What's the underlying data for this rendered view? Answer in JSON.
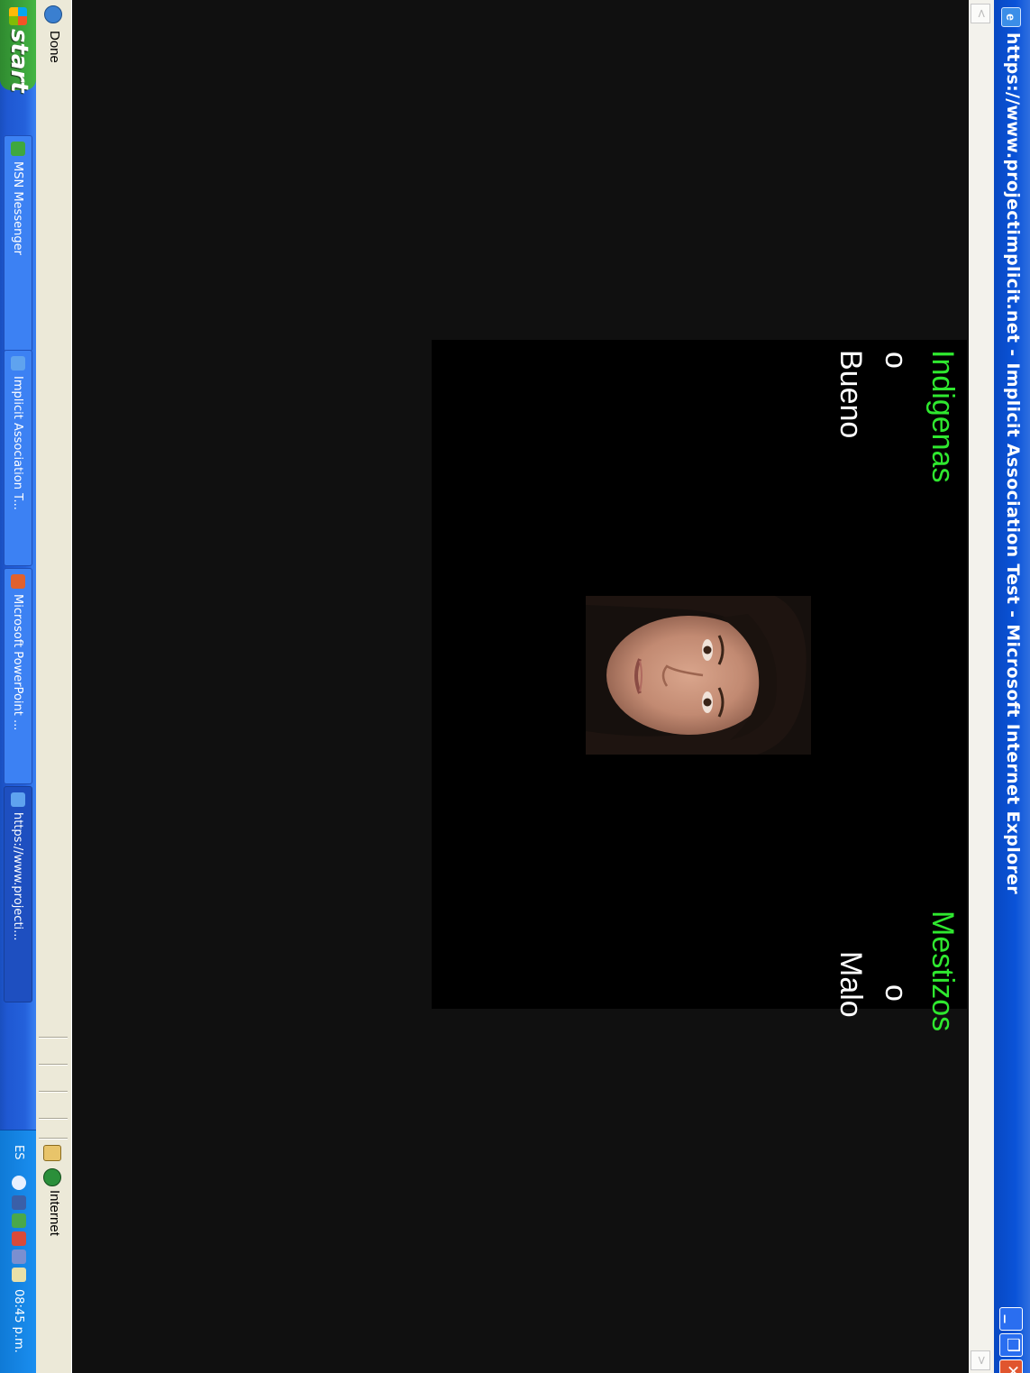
{
  "window": {
    "title": "https://www.projectimplicit.net - Implicit Association Test - Microsoft Internet Explorer",
    "app_icon": "ie-icon",
    "controls": {
      "minimize": "_",
      "restore": "❐",
      "close": "✕"
    }
  },
  "scrollbar": {
    "left_arrow": "<",
    "right_arrow": ">"
  },
  "iat": {
    "left_category": "Indigenas",
    "left_separator": "o",
    "left_attribute": "Bueno",
    "right_category": "Mestizos",
    "right_separator": "o",
    "right_attribute": "Malo",
    "stimulus": "face-photo",
    "colors": {
      "category": "#2fe82f",
      "attribute": "#ffffff",
      "panel": "#000000"
    }
  },
  "statusbar": {
    "status": "Done",
    "zone": "Internet"
  },
  "taskbar": {
    "start_label": "start",
    "tasks": [
      {
        "label": "MSN Messenger",
        "icon": "msn-icon"
      },
      {
        "label": "Implicit Association T...",
        "icon": "ie-icon"
      },
      {
        "label": "Microsoft PowerPoint ...",
        "icon": "powerpoint-icon"
      },
      {
        "label": "https://www.projecti...",
        "icon": "ie-icon"
      }
    ],
    "tray": {
      "language": "ES",
      "clock": "08:45 p.m."
    }
  }
}
